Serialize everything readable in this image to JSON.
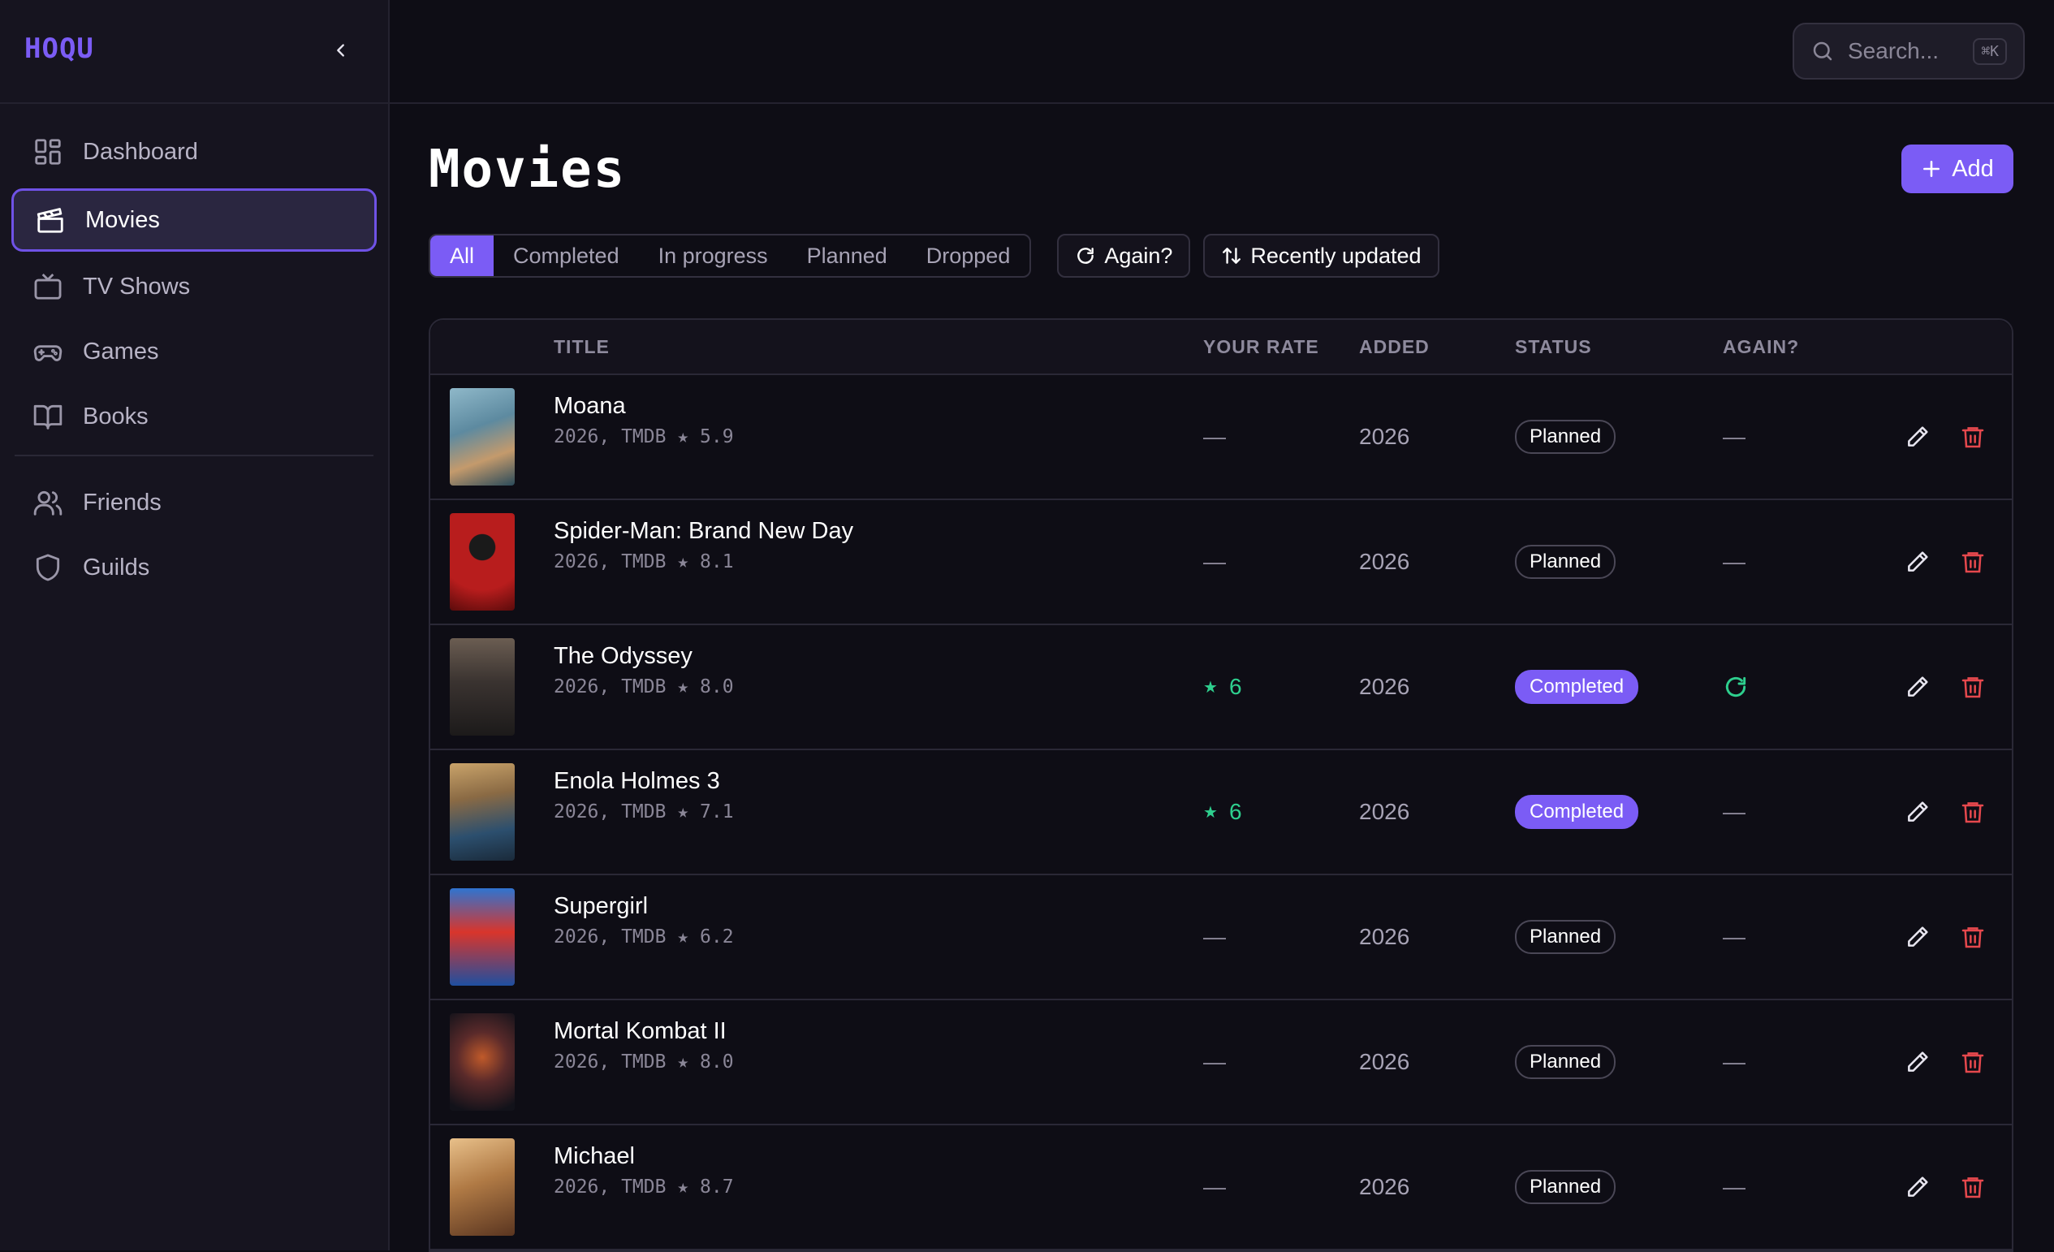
{
  "app": {
    "logo": "HOQU",
    "accent": "#7b5cf5",
    "danger": "#e5484d",
    "success": "#2ecf8e"
  },
  "sidebar": {
    "items": [
      {
        "label": "Dashboard",
        "icon": "dashboard-icon",
        "active": false
      },
      {
        "label": "Movies",
        "icon": "clapperboard-icon",
        "active": true
      },
      {
        "label": "TV Shows",
        "icon": "tv-icon",
        "active": false
      },
      {
        "label": "Games",
        "icon": "gamepad-icon",
        "active": false
      },
      {
        "label": "Books",
        "icon": "book-icon",
        "active": false
      },
      {
        "label": "Friends",
        "icon": "users-icon",
        "active": false
      },
      {
        "label": "Guilds",
        "icon": "shield-icon",
        "active": false
      }
    ]
  },
  "search": {
    "placeholder": "Search...",
    "shortcut": "⌘K"
  },
  "page": {
    "title": "Movies",
    "add_label": "Add"
  },
  "filters": {
    "tabs": [
      "All",
      "Completed",
      "In progress",
      "Planned",
      "Dropped"
    ],
    "active": "All",
    "again_label": "Again?",
    "sort_label": "Recently updated"
  },
  "table": {
    "headers": {
      "title": "TITLE",
      "rate": "YOUR RATE",
      "added": "ADDED",
      "status": "STATUS",
      "again": "AGAIN?"
    },
    "rows": [
      {
        "title": "Moana",
        "sub": "2026, TMDB ★ 5.9",
        "rate": "—",
        "added": "2026",
        "status": "Planned",
        "again": "—"
      },
      {
        "title": "Spider-Man: Brand New Day",
        "sub": "2026, TMDB ★ 8.1",
        "rate": "—",
        "added": "2026",
        "status": "Planned",
        "again": "—"
      },
      {
        "title": "The Odyssey",
        "sub": "2026, TMDB ★ 8.0",
        "rate": "6",
        "added": "2026",
        "status": "Completed",
        "again": "rewatch-icon"
      },
      {
        "title": "Enola Holmes 3",
        "sub": "2026, TMDB ★ 7.1",
        "rate": "6",
        "added": "2026",
        "status": "Completed",
        "again": "—"
      },
      {
        "title": "Supergirl",
        "sub": "2026, TMDB ★ 6.2",
        "rate": "—",
        "added": "2026",
        "status": "Planned",
        "again": "—"
      },
      {
        "title": "Mortal Kombat II",
        "sub": "2026, TMDB ★ 8.0",
        "rate": "—",
        "added": "2026",
        "status": "Planned",
        "again": "—"
      },
      {
        "title": "Michael",
        "sub": "2026, TMDB ★ 8.7",
        "rate": "—",
        "added": "2026",
        "status": "Planned",
        "again": "—"
      }
    ]
  }
}
